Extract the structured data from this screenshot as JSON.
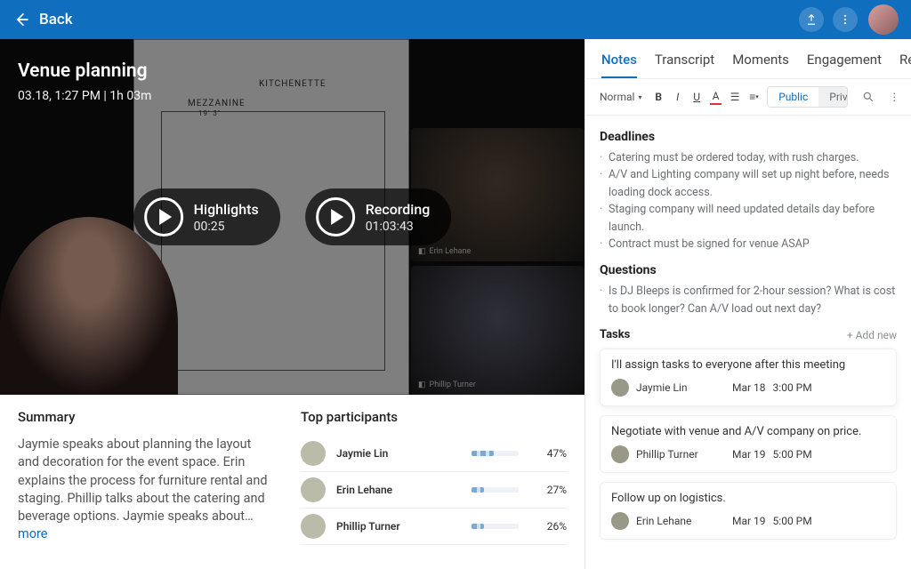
{
  "header": {
    "back_label": "Back"
  },
  "meeting": {
    "title": "Venue planning",
    "subtitle": "03.18, 1:27 PM | 1h 03m"
  },
  "pills": {
    "highlights_label": "Highlights",
    "highlights_time": "00:25",
    "recording_label": "Recording",
    "recording_time": "01:03:43"
  },
  "video_labels": {
    "pv1": "Erin Lehane",
    "pv2": "Phillip Turner"
  },
  "floorplan": {
    "kitchenette": "KITCHENETTE",
    "mezz": "MEZZANINE",
    "dim": "19' 3\""
  },
  "summary": {
    "heading": "Summary",
    "text": "Jaymie speaks about planning the layout and decoration for the event space. Erin explains the process for furniture rental and staging. Phillip talks about the catering and beverage options. Jaymie speaks about…",
    "more": "more"
  },
  "participants": {
    "heading": "Top participants",
    "rows": [
      {
        "name": "Jaymie Lin",
        "pct": "47%",
        "width": "47%"
      },
      {
        "name": "Erin Lehane",
        "pct": "27%",
        "width": "27%"
      },
      {
        "name": "Phillip Turner",
        "pct": "26%",
        "width": "26%"
      }
    ]
  },
  "tabs": {
    "notes": "Notes",
    "transcript": "Transcript",
    "moments": "Moments",
    "engagement": "Engagement",
    "report": "Report"
  },
  "toolbar": {
    "style": "Normal",
    "public": "Public",
    "private": "Private"
  },
  "notes": {
    "deadlines_h": "Deadlines",
    "deadlines": [
      "Catering must be ordered today, with rush charges.",
      "A/V and Lighting company will set up night before, needs loading dock access.",
      "Staging company will need updated details day before launch.",
      "Contract must be signed for venue ASAP"
    ],
    "questions_h": "Questions",
    "questions": [
      "Is DJ Bleeps is confirmed for 2-hour session? What is cost to book longer? Can A/V load out next day?"
    ],
    "tasks_h": "Tasks",
    "add_new": "+  Add new",
    "tasks": [
      {
        "title": "I'll assign tasks to everyone after this meeting",
        "assignee": "Jaymie Lin",
        "date": "Mar 18",
        "time": "3:00 PM"
      },
      {
        "title": "Negotiate with venue and A/V company on price.",
        "assignee": "Phillip Turner",
        "date": "Mar 19",
        "time": "5:00 PM"
      },
      {
        "title": "Follow up on logistics.",
        "assignee": "Erin Lehane",
        "date": "Mar 19",
        "time": "5:00 PM"
      }
    ]
  }
}
